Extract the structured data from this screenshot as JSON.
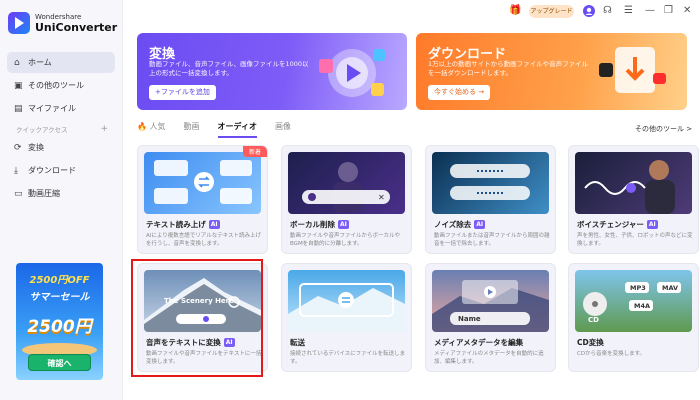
{
  "app": {
    "brand_small": "Wondershare",
    "brand_big": "UniConverter"
  },
  "sidebar": {
    "items": [
      {
        "icon": "⌂",
        "label": "ホーム"
      },
      {
        "icon": "▣",
        "label": "その他のツール"
      },
      {
        "icon": "▤",
        "label": "マイファイル"
      }
    ],
    "quick_access_label": "クイックアクセス",
    "quick_add": "+",
    "quick_items": [
      {
        "icon": "⟳",
        "label": "変換"
      },
      {
        "icon": "⤓",
        "label": "ダウンロード"
      },
      {
        "icon": "▭",
        "label": "動画圧縮"
      }
    ]
  },
  "promo": {
    "line1": "2500円OFF",
    "line2": "サマーセール",
    "big": "2500円",
    "button": "確認へ"
  },
  "topbar": {
    "upgrade": "アップグレード"
  },
  "banners": [
    {
      "title": "変換",
      "desc": "動画ファイル、音声ファイル、画像ファイルを1000以上の形式に一括変換します。",
      "button": "+ファイルを追加"
    },
    {
      "title": "ダウンロード",
      "desc": "1万以上の動画サイトから動画ファイルや音声ファイルを一括ダウンロードします。",
      "button": "今すぐ始める →"
    }
  ],
  "tabs": [
    "人気",
    "動画",
    "オーディオ",
    "画像"
  ],
  "more_tools": "その他のツール >",
  "cards": [
    {
      "title": "テキスト読み上げ",
      "ai": "AI",
      "badge": "新着",
      "desc": "AIにより複数言語でリアルなテキスト読み上げを行うし、音声を変換します。"
    },
    {
      "title": "ボーカル削除",
      "ai": "AI",
      "badge": "",
      "desc": "動画ファイルや音声ファイルからボーカルやBGMを自動的に分離します。"
    },
    {
      "title": "ノイズ除去",
      "ai": "AI",
      "badge": "",
      "desc": "動画ファイルまたは音声ファイルから周囲の雑音を一括で除去します。"
    },
    {
      "title": "ボイスチェンジャー",
      "ai": "AI",
      "badge": "",
      "desc": "声を男性、女性、子供、ロボットの声などに変換します。"
    },
    {
      "title": "音声をテキストに変換",
      "ai": "AI",
      "badge": "",
      "desc": "動画ファイルや音声ファイルをテキストに一括変換します。"
    },
    {
      "title": "転送",
      "ai": "",
      "badge": "",
      "desc": "接続されているデバイスにファイルを転送します。"
    },
    {
      "title": "メディアメタデータを編集",
      "ai": "",
      "badge": "",
      "desc": "メディアファイルのメタデータを自動的に追加、編集します。"
    },
    {
      "title": "CD変換",
      "ai": "",
      "badge": "",
      "desc": "CDから音楽を変換します。"
    }
  ],
  "thumb_text": {
    "scenery": "The Scenery Here",
    "name": "Name",
    "mp3": "MP3",
    "mav": "MAV",
    "m4a": "M4A",
    "cd": "CD"
  }
}
